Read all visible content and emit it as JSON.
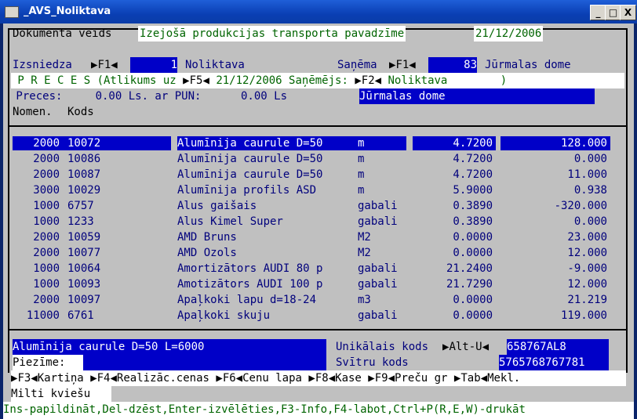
{
  "window": {
    "title": "_AVS_Noliktava",
    "min": "_",
    "max": "□",
    "close": "X"
  },
  "doc": {
    "label": "Dokumenta veids",
    "type": "Izejošā produkcijas transporta pavadzīme",
    "date": "21/12/2006"
  },
  "issuer": {
    "label": "Izsniedza",
    "key": "F1",
    "num": "1",
    "name": "Noliktava"
  },
  "receiver": {
    "label": "Saņēma",
    "key": "F1",
    "num": "83",
    "name": "Jūrmalas dome"
  },
  "goods_header": {
    "text1": " P R E C E S (Atlikums uz ",
    "key1": "F5",
    "text2": " 21/12/2006 Saņēmējs: ",
    "key2": "F2",
    "text3": " Noliktava        )"
  },
  "summary": {
    "text": " Preces:     0.00 Ls. ar PUN:      0.00 Ls",
    "dest": "Jūrmalas dome"
  },
  "columns": {
    "nomen": "Nomen.",
    "code": "Kods"
  },
  "rows": [
    {
      "nomen": "2000",
      "code": "10072",
      "name": "Alumīnija caurule D=50",
      "unit": "m",
      "price": "4.7200",
      "qty": "128.000"
    },
    {
      "nomen": "2000",
      "code": "10086",
      "name": "Alumīnija caurule D=50",
      "unit": "m",
      "price": "4.7200",
      "qty": "0.000"
    },
    {
      "nomen": "2000",
      "code": "10087",
      "name": "Alumīnija caurule D=50",
      "unit": "m",
      "price": "4.7200",
      "qty": "11.000"
    },
    {
      "nomen": "3000",
      "code": "10029",
      "name": "Alumīnija profils ASD",
      "unit": "m",
      "price": "5.9000",
      "qty": "0.938"
    },
    {
      "nomen": "1000",
      "code": "6757",
      "name": "Alus gaišais",
      "unit": "gabali",
      "price": "0.3890",
      "qty": "-320.000"
    },
    {
      "nomen": "1000",
      "code": "1233",
      "name": "Alus Kimel Super",
      "unit": "gabali",
      "price": "0.3890",
      "qty": "0.000"
    },
    {
      "nomen": "2000",
      "code": "10059",
      "name": "AMD Bruns",
      "unit": "M2",
      "price": "0.0000",
      "qty": "23.000"
    },
    {
      "nomen": "2000",
      "code": "10077",
      "name": "AMD Ozols",
      "unit": "M2",
      "price": "0.0000",
      "qty": "12.000"
    },
    {
      "nomen": "1000",
      "code": "10064",
      "name": "Amortizātors AUDI 80 p",
      "unit": "gabali",
      "price": "21.2400",
      "qty": "-9.000"
    },
    {
      "nomen": "1000",
      "code": "10093",
      "name": "Amotizātors AUDI 100 p",
      "unit": "gabali",
      "price": "21.7290",
      "qty": "12.000"
    },
    {
      "nomen": "2000",
      "code": "10097",
      "name": "Apaļkoki lapu d=18-24",
      "unit": "m3",
      "price": "0.0000",
      "qty": "21.219"
    },
    {
      "nomen": "11000",
      "code": "6761",
      "name": "Apaļkoki skuju",
      "unit": "gabali",
      "price": "0.0000",
      "qty": "119.000"
    }
  ],
  "detail": {
    "full_name": "Alumīnija caurule D=50 L=6000",
    "unique_label": "Unikālais kods",
    "unique_key": "Alt-U",
    "unique_value": "658767AL8",
    "note_label": "Piezīme:",
    "barcode_label": "Svītru kods",
    "barcode_value": "5765768767781"
  },
  "fkeys": [
    {
      "key": "F3",
      "label": "Kartiņa"
    },
    {
      "key": "F4",
      "label": "Realizāc.cenas"
    },
    {
      "key": "F6",
      "label": "Cenu lapa"
    },
    {
      "key": "F8",
      "label": "Kase"
    },
    {
      "key": "F9",
      "label": "Preču gr"
    },
    {
      "key": "Tab",
      "label": "Mekl."
    }
  ],
  "group_name": "Milti kviešu",
  "status": "Ins-papildināt,Del-dzēst,Enter-izvēlēties,F3-Info,F4-labot,Ctrl+P(R,E,W)-drukāt"
}
